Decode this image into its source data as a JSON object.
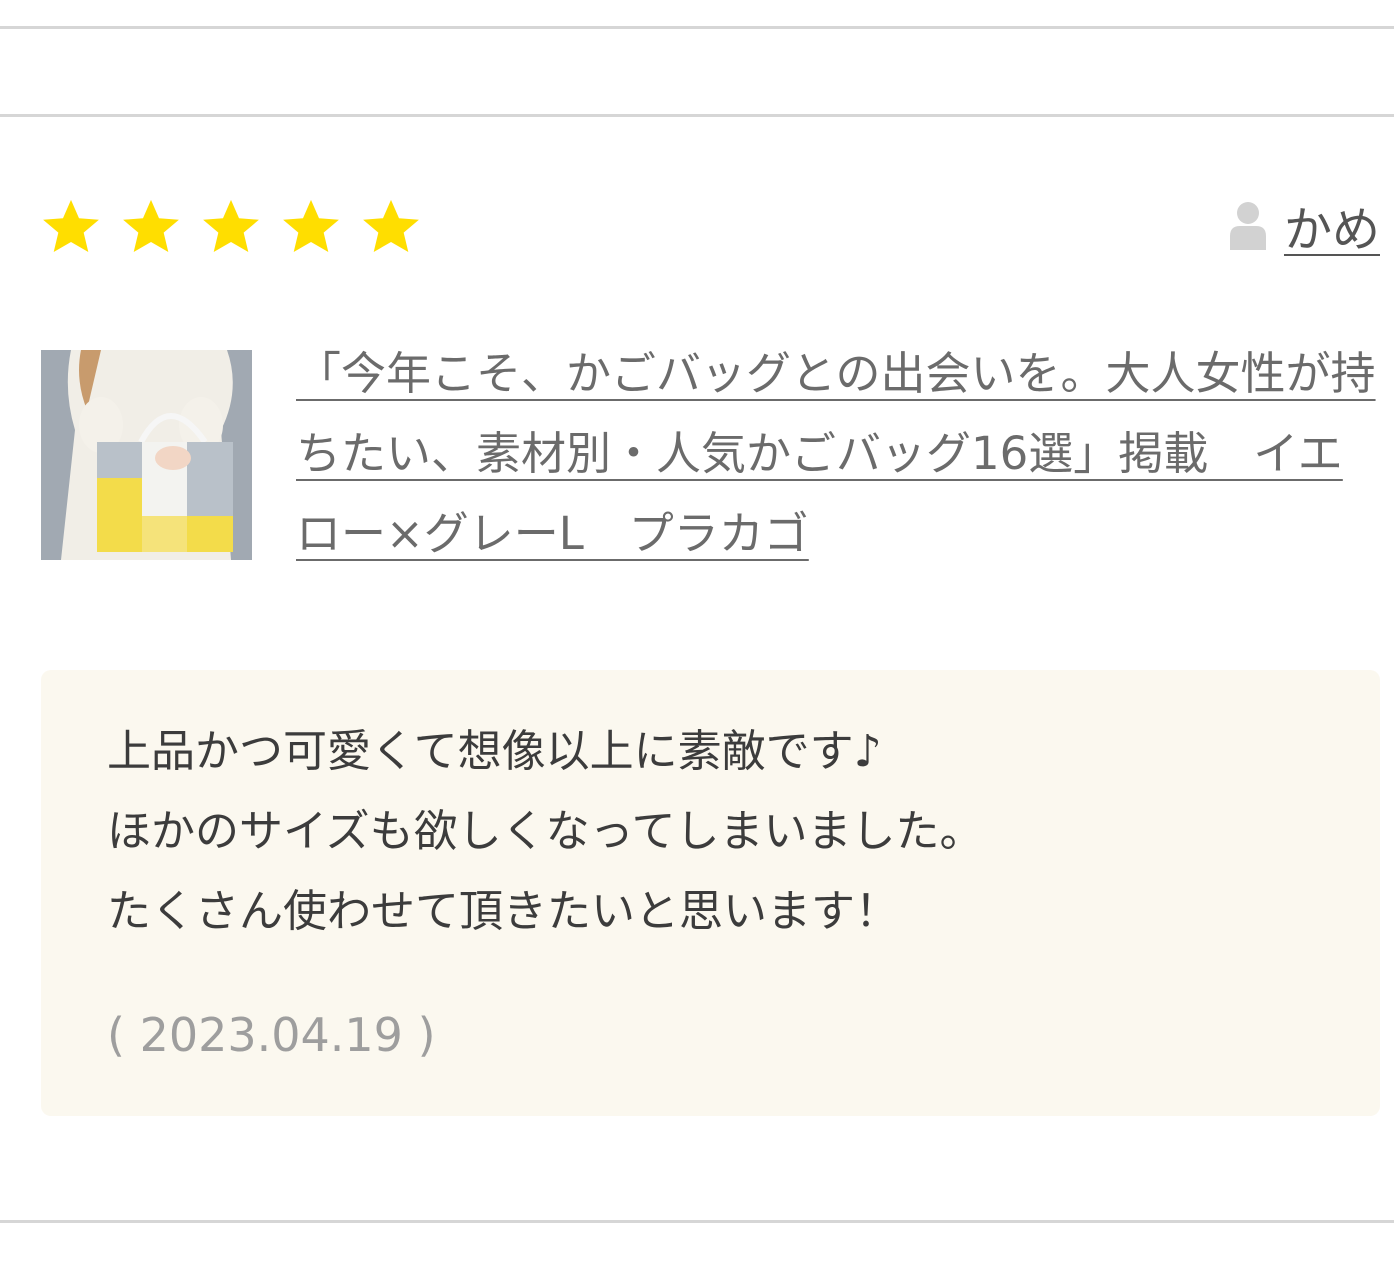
{
  "review": {
    "rating": 5,
    "rating_max": 5,
    "star_color": "#ffde00",
    "reviewer": {
      "icon": "user-icon",
      "name": "かめ"
    },
    "product": {
      "thumbnail_icon": "product-photo",
      "title": "「今年こそ、かごバッグとの出会いを。大人女性が持ちたい、素材別・人気かごバッグ16選」掲載　イエロー×グレーL　プラカゴ"
    },
    "body_lines": [
      "上品かつ可愛くて想像以上に素敵です♪",
      "ほかのサイズも欲しくなってしまいました。",
      "たくさん使わせて頂きたいと思います！"
    ],
    "date": "( 2023.04.19 )",
    "box_color": "#fbf8ef"
  }
}
